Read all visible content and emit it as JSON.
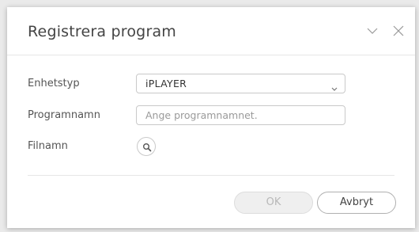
{
  "dialog": {
    "title": "Registrera program",
    "icons": {
      "collapse": "chevron-down-icon",
      "close": "close-icon"
    }
  },
  "form": {
    "device_type": {
      "label": "Enhetstyp",
      "value": "iPLAYER"
    },
    "program_name": {
      "label": "Programnamn",
      "value": "",
      "placeholder": "Ange programnamnet."
    },
    "file_name": {
      "label": "Filnamn",
      "icon": "search-icon"
    }
  },
  "buttons": {
    "ok": "OK",
    "cancel": "Avbryt"
  },
  "colors": {
    "background": "#eaeaea",
    "dialog": "#ffffff",
    "border": "#c9c9c9",
    "disabled_text": "#b8b8b8"
  }
}
